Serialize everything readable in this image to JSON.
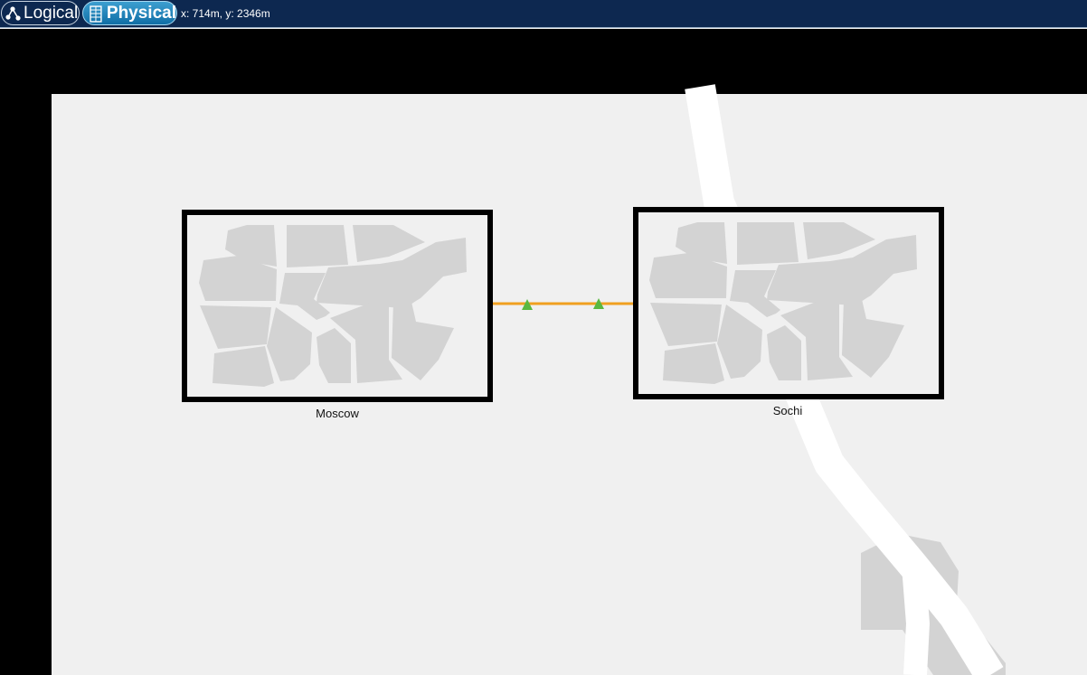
{
  "toolbar": {
    "logical_label": "Logical",
    "physical_label": "Physical",
    "cursor_readout": "x: 714m, y: 2346m"
  },
  "map": {
    "sites": [
      {
        "name": "Moscow"
      },
      {
        "name": "Sochi"
      }
    ],
    "link": {
      "color": "#f0a020",
      "endpoint_color": "#5ab840"
    },
    "colors": {
      "background": "#f0f0f0",
      "border": "#000000",
      "road": "#ffffff",
      "blocks": "#d3d3d3",
      "toolbar": "#0d2850",
      "active_tab": "#1f86bd"
    },
    "icons": [
      "logical-graph-icon",
      "physical-building-icon",
      "city-map-icon",
      "link-endpoint-icon"
    ]
  }
}
